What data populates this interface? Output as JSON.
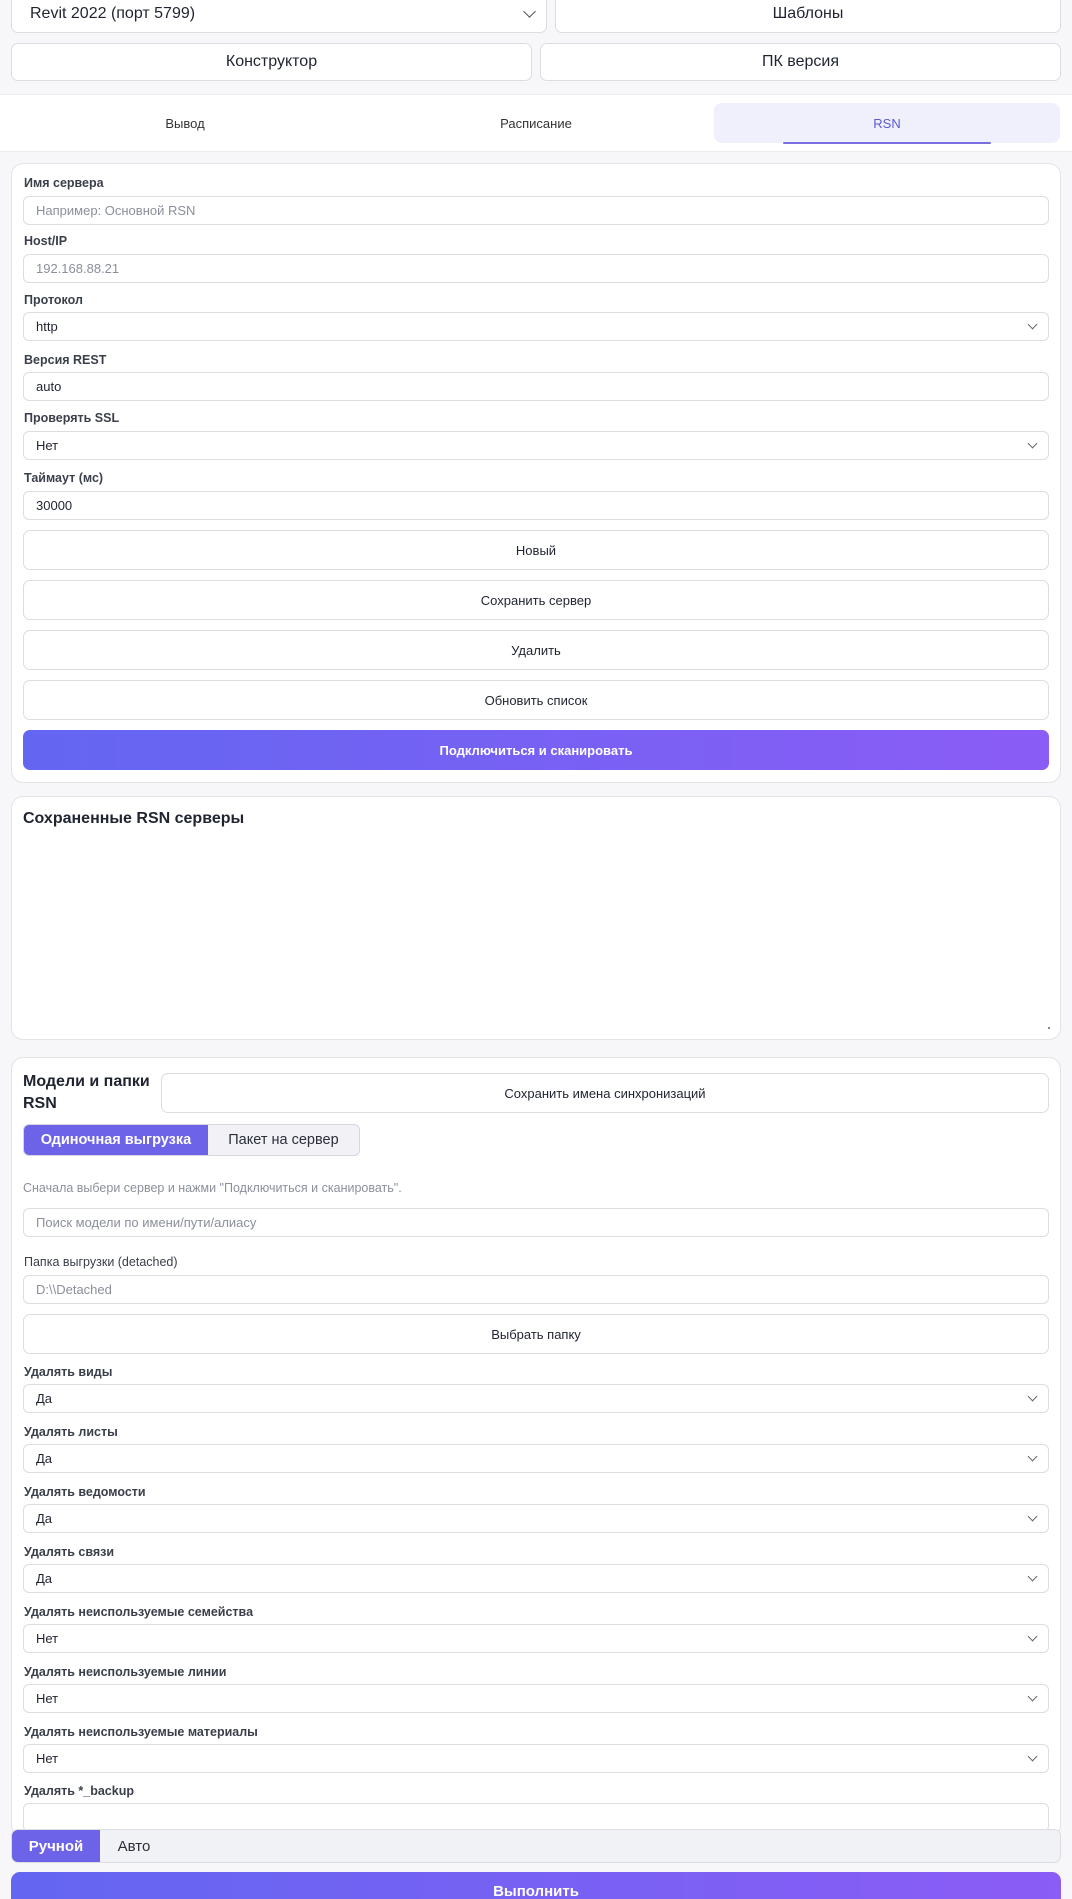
{
  "top": {
    "revit_select": "Revit 2022 (порт 5799)",
    "templates": "Шаблоны",
    "constructor": "Конструктор",
    "pc_version": "ПК версия"
  },
  "tabs": [
    {
      "label": "Вывод",
      "active": false
    },
    {
      "label": "Расписание",
      "active": false
    },
    {
      "label": "RSN",
      "active": true
    }
  ],
  "server_form": {
    "name_label": "Имя сервера",
    "name_placeholder": "Например: Основной RSN",
    "host_label": "Host/IP",
    "host_value": "192.168.88.21",
    "protocol_label": "Протокол",
    "protocol_value": "http",
    "rest_label": "Версия REST",
    "rest_value": "auto",
    "ssl_label": "Проверять SSL",
    "ssl_value": "Нет",
    "timeout_label": "Таймаут (мс)",
    "timeout_value": "30000",
    "new_btn": "Новый",
    "save_btn": "Сохранить сервер",
    "delete_btn": "Удалить",
    "refresh_btn": "Обновить список",
    "connect_btn": "Подключиться и сканировать"
  },
  "saved_servers": {
    "title": "Сохраненные RSN серверы"
  },
  "models": {
    "title_line1": "Модели и папки",
    "title_line2": "RSN",
    "save_sync_btn": "Сохранить имена синхронизаций",
    "mode_single": "Одиночная выгрузка",
    "mode_batch": "Пакет на сервер",
    "hint": "Сначала выбери сервер и нажми \"Подключиться и сканировать\".",
    "search_placeholder": "Поиск модели по имени/пути/алиасу",
    "folder_label": "Папка выгрузки (detached)",
    "folder_value": "D:\\\\Detached",
    "choose_folder_btn": "Выбрать папку",
    "options": [
      {
        "label": "Удалять виды",
        "value": "Да"
      },
      {
        "label": "Удалять листы",
        "value": "Да"
      },
      {
        "label": "Удалять ведомости",
        "value": "Да"
      },
      {
        "label": "Удалять связи",
        "value": "Да"
      },
      {
        "label": "Удалять неиспользуемые семейства",
        "value": "Нет"
      },
      {
        "label": "Удалять неиспользуемые линии",
        "value": "Нет"
      },
      {
        "label": "Удалять неиспользуемые материалы",
        "value": "Нет"
      },
      {
        "label": "Удалять *_backup",
        "value": ""
      }
    ]
  },
  "bottom": {
    "manual": "Ручной",
    "auto": "Авто",
    "run": "Выполнить"
  },
  "colors": {
    "accent": "#6c63e8",
    "gradient_start": "#6366f1",
    "gradient_end": "#8b5cf6"
  }
}
